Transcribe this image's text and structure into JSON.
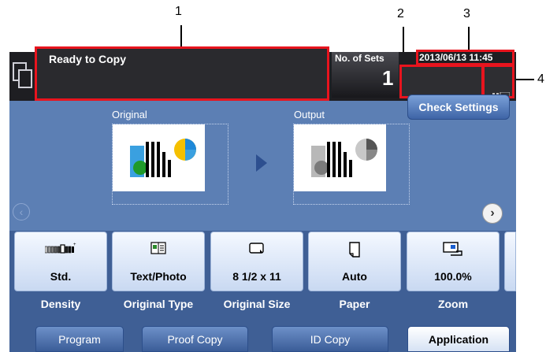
{
  "callouts": [
    "1",
    "2",
    "3",
    "4"
  ],
  "status": {
    "message": "Ready to Copy",
    "sets_label": "No. of Sets",
    "sets_value": "1",
    "datetime": "2013/06/13 11:45",
    "check_settings": "Check Settings"
  },
  "preview": {
    "original_label": "Original",
    "output_label": "Output"
  },
  "function_keys": [
    {
      "value": "Std.",
      "label": "Density",
      "icon": "density-icon"
    },
    {
      "value": "Text/Photo",
      "label": "Original Type",
      "icon": "original-type-icon"
    },
    {
      "value": "8 1/2 x 11",
      "label": "Original Size",
      "icon": "original-size-icon"
    },
    {
      "value": "Auto",
      "label": "Paper",
      "icon": "paper-icon"
    },
    {
      "value": "100.0%",
      "label": "Zoom",
      "icon": "zoom-icon"
    }
  ],
  "tabs": [
    {
      "label": "Program",
      "active": false
    },
    {
      "label": "Proof Copy",
      "active": false
    },
    {
      "label": "ID Copy",
      "active": false
    },
    {
      "label": "Application",
      "active": true
    }
  ],
  "colors": {
    "highlight": "#e8141e",
    "panel_blue": "#5c7fb4",
    "status_dark": "#1e1e22"
  }
}
